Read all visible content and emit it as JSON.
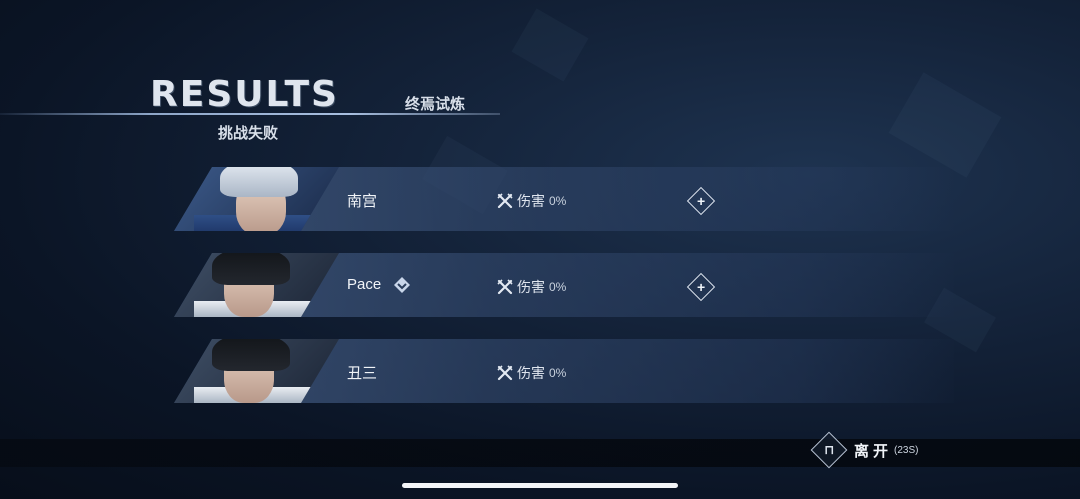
{
  "header": {
    "title": "RESULTS",
    "mode_name": "终焉试炼",
    "status": "挑战失败"
  },
  "players": [
    {
      "name": "南宫",
      "damage_label": "伤害",
      "damage_value": "0%",
      "has_add_button": true,
      "has_badge": false
    },
    {
      "name": "Pace",
      "damage_label": "伤害",
      "damage_value": "0%",
      "has_add_button": true,
      "has_badge": true
    },
    {
      "name": "丑三",
      "damage_label": "伤害",
      "damage_value": "0%",
      "has_add_button": false,
      "has_badge": false
    }
  ],
  "footer": {
    "leave_label": "离开",
    "leave_timer": "(23S)"
  },
  "colors": {
    "background": "#0b1526",
    "row_fill": "#465f87",
    "accent_line": "#8ea6c8"
  }
}
